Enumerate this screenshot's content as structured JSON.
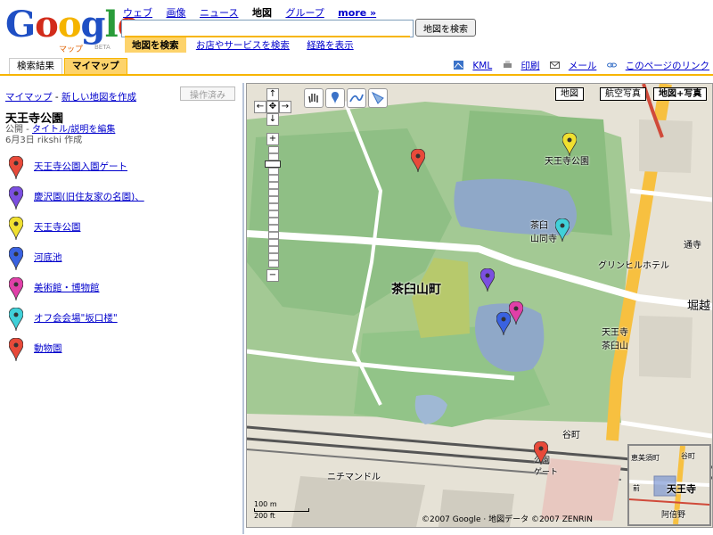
{
  "logo": {
    "text": "Google",
    "sub": "マップ",
    "beta": "BETA"
  },
  "top_nav": [
    {
      "label": "ウェブ",
      "current": false
    },
    {
      "label": "画像",
      "current": false
    },
    {
      "label": "ニュース",
      "current": false
    },
    {
      "label": "地図",
      "current": true
    },
    {
      "label": "グループ",
      "current": false
    },
    {
      "label": "more »",
      "current": false
    }
  ],
  "search": {
    "value": "",
    "button_label": "地図を検索"
  },
  "search_tabs": [
    {
      "label": "地図を検索",
      "active": true
    },
    {
      "label": "お店やサービスを検索",
      "active": false
    },
    {
      "label": "経路を表示",
      "active": false
    }
  ],
  "result_tabs": [
    {
      "label": "検索結果",
      "active": false
    },
    {
      "label": "マイマップ",
      "active": true
    }
  ],
  "map_links": {
    "kml": "KML",
    "print": "印刷",
    "mail": "メール",
    "link": "このページのリンク"
  },
  "sidebar": {
    "my_maps_link": "マイマップ",
    "separator": "-",
    "new_map_link": "新しい地図を作成",
    "edit_button": "操作済み",
    "title": "天王寺公園",
    "status": "公開",
    "edit_link": "タイトル/説明を編集",
    "date_author": "6月3日 rikshi 作成",
    "places": [
      {
        "label": "天王寺公園入園ゲート",
        "color": "#e84a3a"
      },
      {
        "label": "慶沢園(旧住友家の名園)、",
        "color": "#7b4fe0"
      },
      {
        "label": "天王寺公園",
        "color": "#f0e030"
      },
      {
        "label": "河底池",
        "color": "#3a62e0"
      },
      {
        "label": "美術館・博物館",
        "color": "#e040a8"
      },
      {
        "label": "オフ会会場\"坂口楼\"",
        "color": "#40d0d8"
      },
      {
        "label": "動物園",
        "color": "#e84a3a"
      }
    ]
  },
  "map": {
    "types": [
      {
        "label": "地図",
        "selected": false
      },
      {
        "label": "航空写真",
        "selected": false
      },
      {
        "label": "地図+写真",
        "selected": true
      }
    ],
    "labels": {
      "park": "天王寺公園",
      "sakaiguchi": "茶臼\n山同寺",
      "hotel": "グリンヒルホテル",
      "chausu": "茶臼山町",
      "tennoji": "天王寺\n茶臼山",
      "nichimanto": "ニチマンドル",
      "zoo_gate": "公園\nゲート",
      "horikoshi": "堀越",
      "chou": "通寺",
      "tanimachi": "谷町"
    },
    "scale": {
      "metric": "100 m",
      "imperial": "200 ft"
    },
    "copyright": "©2007 Google · 地図データ ©2007 ZENRIN",
    "overview_labels": {
      "tennoji": "天王寺",
      "abeno": "阿倍野",
      "tanimachi": "谷町",
      "ebisu": "恵美須町",
      "mae": "前"
    }
  },
  "colors": {
    "accent": "#f7b500",
    "link": "#0000cc",
    "tab_active": "#fdd36b"
  }
}
